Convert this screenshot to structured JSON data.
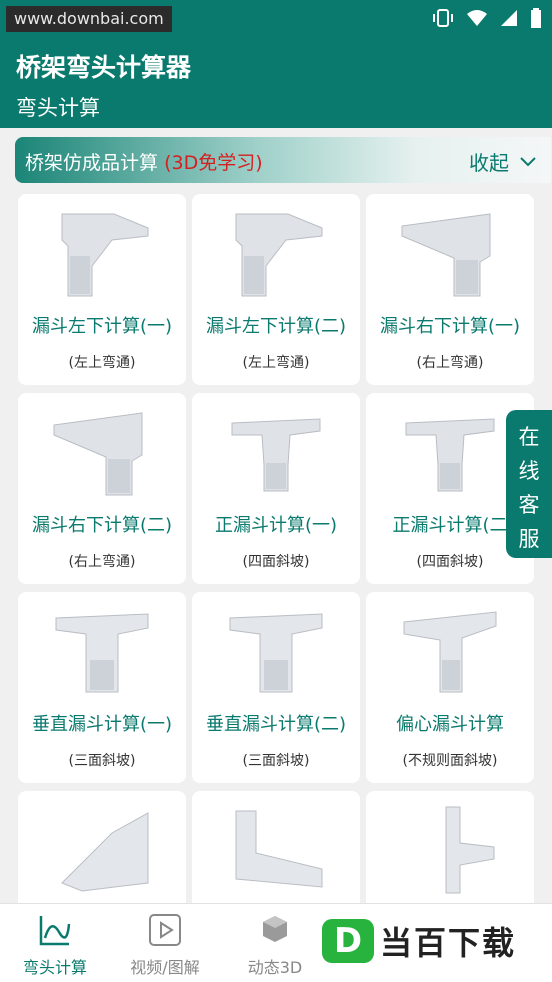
{
  "status": {
    "watermark": "www.downbai.com"
  },
  "header": {
    "title": "桥架弯头计算器",
    "subtitle": "弯头计算"
  },
  "section": {
    "title": "桥架仿成品计算",
    "badge": "(3D免学习)",
    "collapse_label": "收起"
  },
  "cards": [
    {
      "name": "漏斗左下计算(一)",
      "note": "(左上弯通)"
    },
    {
      "name": "漏斗左下计算(二)",
      "note": "(左上弯通)"
    },
    {
      "name": "漏斗右下计算(一)",
      "note": "(右上弯通)"
    },
    {
      "name": "漏斗右下计算(二)",
      "note": "(右上弯通)"
    },
    {
      "name": "正漏斗计算(一)",
      "note": "(四面斜坡)"
    },
    {
      "name": "正漏斗计算(二",
      "note": "(四面斜坡)"
    },
    {
      "name": "垂直漏斗计算(一)",
      "note": "(三面斜坡)"
    },
    {
      "name": "垂直漏斗计算(二)",
      "note": "(三面斜坡)"
    },
    {
      "name": "偏心漏斗计算",
      "note": "(不规则面斜坡)"
    },
    {
      "name": "",
      "note": ""
    },
    {
      "name": "",
      "note": ""
    },
    {
      "name": "",
      "note": ""
    }
  ],
  "float_service": [
    "在",
    "线",
    "客",
    "服"
  ],
  "nav": [
    {
      "label": "弯头计算",
      "icon": "chart-icon"
    },
    {
      "label": "视频/图解",
      "icon": "video-icon"
    },
    {
      "label": "动态3D",
      "icon": "cube-icon"
    }
  ],
  "brand": {
    "letter": "D",
    "text": "当百下载"
  },
  "colors": {
    "primary": "#0b7a6e",
    "accent_red": "#d42020",
    "brand_green": "#27b33d"
  }
}
